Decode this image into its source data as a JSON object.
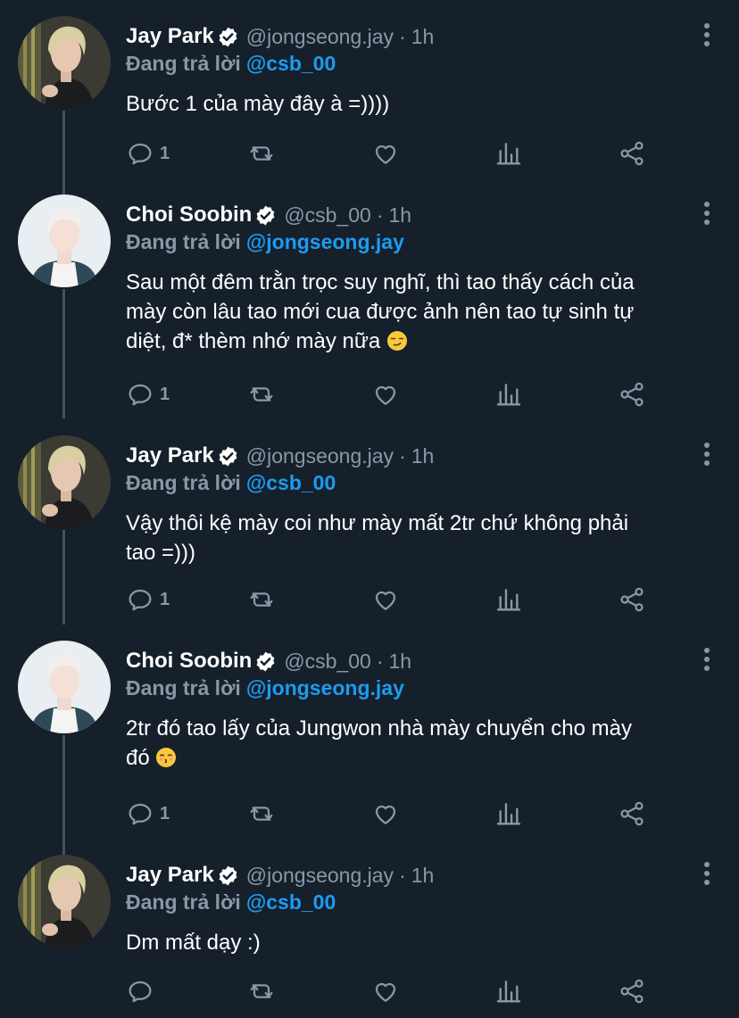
{
  "colors": {
    "background": "#15202b",
    "secondary_text": "#8899a6",
    "link": "#1d9bf0",
    "verified": "#ffffff",
    "thread_line": "#3d5466"
  },
  "tweets": [
    {
      "name": "Jay Park",
      "handle": "@jongseong.jay",
      "dot": "·",
      "time": "1h",
      "reply_label": "Đang trả lời",
      "reply_to": "@csb_00",
      "text_lines": [
        "Bước 1 của mày đây à =))))"
      ],
      "reply_count": "1",
      "avatar": "jay-avatar",
      "emoji": null
    },
    {
      "name": "Choi Soobin",
      "handle": "@csb_00",
      "dot": "·",
      "time": "1h",
      "reply_label": "Đang trả lời",
      "reply_to": "@jongseong.jay",
      "text_lines": [
        "Sau một đêm trằn trọc suy nghĩ, thì tao thấy cách của",
        "mày còn lâu tao mới cua được ảnh nên tao tự sinh tự",
        "diệt, đ* thèm nhớ mày nữa"
      ],
      "reply_count": "1",
      "avatar": "soobin-avatar",
      "emoji": "smirking-face-emoji"
    },
    {
      "name": "Jay Park",
      "handle": "@jongseong.jay",
      "dot": "·",
      "time": "1h",
      "reply_label": "Đang trả lời",
      "reply_to": "@csb_00",
      "text_lines": [
        "Vậy thôi kệ mày coi như mày mất 2tr chứ không phải",
        "tao =)))"
      ],
      "reply_count": "1",
      "avatar": "jay-avatar",
      "emoji": null
    },
    {
      "name": "Choi Soobin",
      "handle": "@csb_00",
      "dot": "·",
      "time": "1h",
      "reply_label": "Đang trả lời",
      "reply_to": "@jongseong.jay",
      "text_lines": [
        "2tr đó tao lấy của Jungwon nhà mày chuyển cho mày",
        "đó"
      ],
      "reply_count": "1",
      "avatar": "soobin-avatar",
      "emoji": "kissing-face-emoji"
    },
    {
      "name": "Jay Park",
      "handle": "@jongseong.jay",
      "dot": "·",
      "time": "1h",
      "reply_label": "Đang trả lời",
      "reply_to": "@csb_00",
      "text_lines": [
        "Dm mất dạy :)"
      ],
      "reply_count": "",
      "avatar": "jay-avatar",
      "emoji": null
    }
  ]
}
